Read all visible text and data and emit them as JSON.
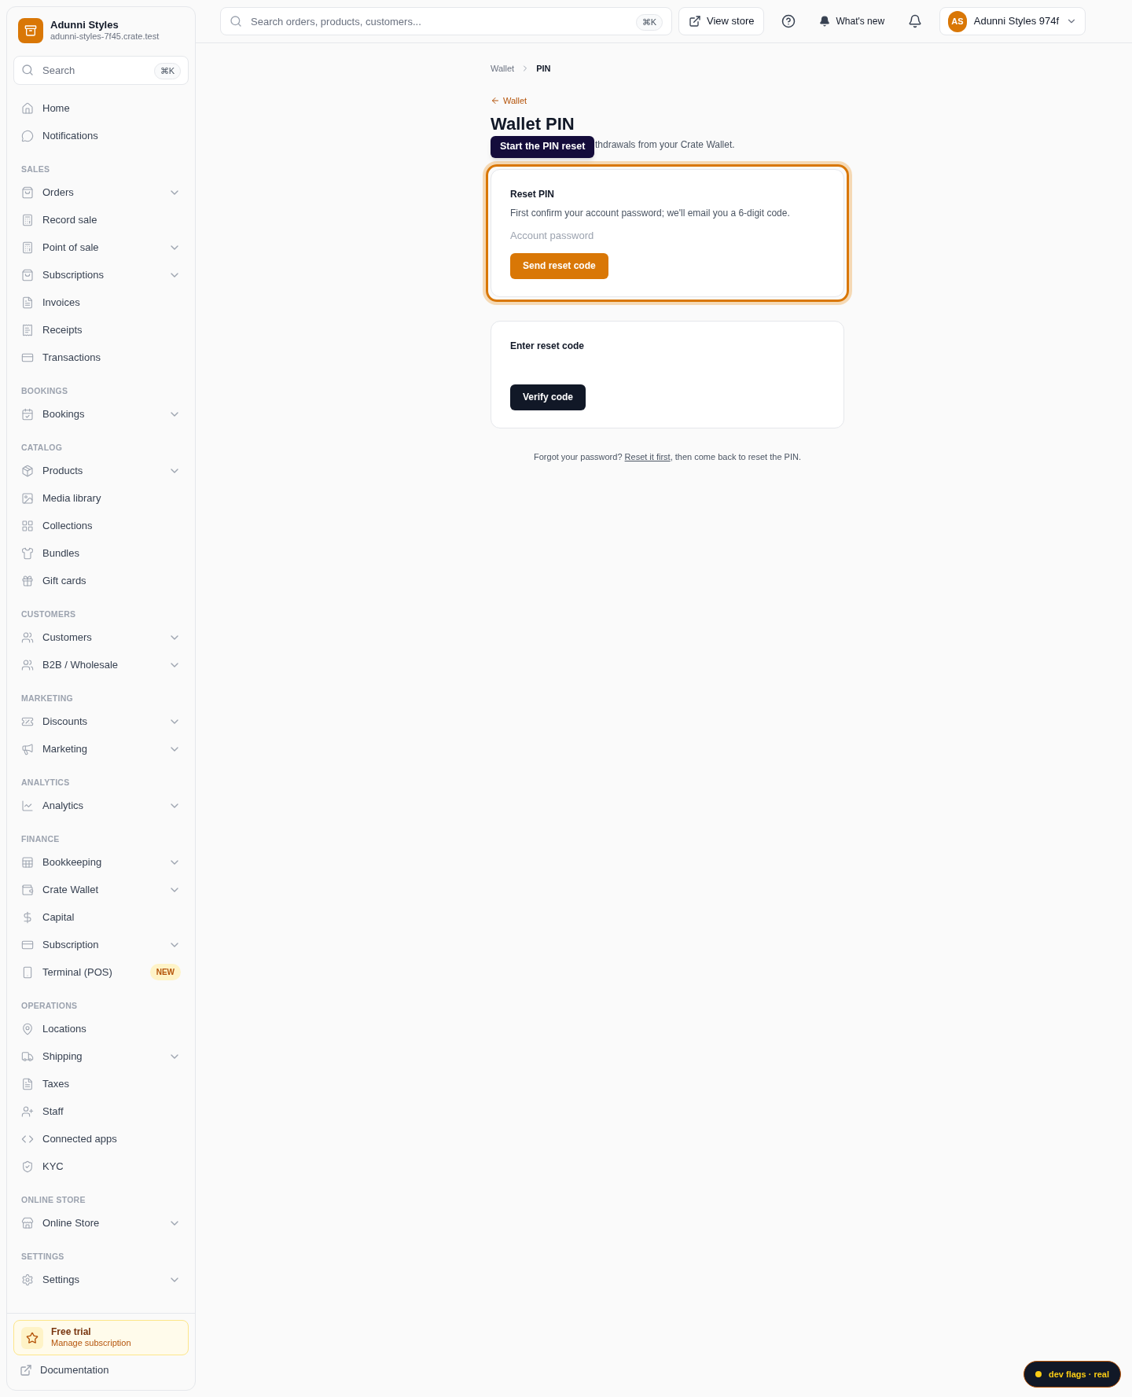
{
  "sidebar": {
    "store_name": "Adunni Styles",
    "store_domain": "adunni-styles-7f45.crate.test",
    "search": {
      "placeholder": "Search",
      "shortcut": "⌘K"
    },
    "top_items": [
      {
        "label": "Home",
        "expandable": false
      },
      {
        "label": "Notifications",
        "expandable": false
      }
    ],
    "sections": [
      {
        "heading": "SALES",
        "items": [
          {
            "label": "Orders",
            "expandable": true
          },
          {
            "label": "Record sale",
            "expandable": false
          },
          {
            "label": "Point of sale",
            "expandable": true
          },
          {
            "label": "Subscriptions",
            "expandable": true
          },
          {
            "label": "Invoices",
            "expandable": false
          },
          {
            "label": "Receipts",
            "expandable": false
          },
          {
            "label": "Transactions",
            "expandable": false
          }
        ]
      },
      {
        "heading": "BOOKINGS",
        "items": [
          {
            "label": "Bookings",
            "expandable": true
          }
        ]
      },
      {
        "heading": "CATALOG",
        "items": [
          {
            "label": "Products",
            "expandable": true
          },
          {
            "label": "Media library",
            "expandable": false
          },
          {
            "label": "Collections",
            "expandable": false
          },
          {
            "label": "Bundles",
            "expandable": false
          },
          {
            "label": "Gift cards",
            "expandable": false
          }
        ]
      },
      {
        "heading": "CUSTOMERS",
        "items": [
          {
            "label": "Customers",
            "expandable": true
          },
          {
            "label": "B2B / Wholesale",
            "expandable": true
          }
        ]
      },
      {
        "heading": "MARKETING",
        "items": [
          {
            "label": "Discounts",
            "expandable": true
          },
          {
            "label": "Marketing",
            "expandable": true
          }
        ]
      },
      {
        "heading": "ANALYTICS",
        "items": [
          {
            "label": "Analytics",
            "expandable": true
          }
        ]
      },
      {
        "heading": "FINANCE",
        "items": [
          {
            "label": "Bookkeeping",
            "expandable": true
          },
          {
            "label": "Crate Wallet",
            "expandable": true
          },
          {
            "label": "Capital",
            "expandable": false
          },
          {
            "label": "Subscription",
            "expandable": true
          },
          {
            "label": "Terminal (POS)",
            "expandable": false,
            "badge": "NEW"
          }
        ]
      },
      {
        "heading": "OPERATIONS",
        "items": [
          {
            "label": "Locations",
            "expandable": false
          },
          {
            "label": "Shipping",
            "expandable": true
          },
          {
            "label": "Taxes",
            "expandable": false
          },
          {
            "label": "Staff",
            "expandable": false
          },
          {
            "label": "Connected apps",
            "expandable": false
          },
          {
            "label": "KYC",
            "expandable": false
          }
        ]
      },
      {
        "heading": "ONLINE STORE",
        "items": [
          {
            "label": "Online Store",
            "expandable": true
          }
        ]
      },
      {
        "heading": "SETTINGS",
        "items": [
          {
            "label": "Settings",
            "expandable": true
          }
        ]
      }
    ],
    "trial": {
      "title": "Free trial",
      "link": "Manage subscription"
    },
    "documentation": "Documentation"
  },
  "header": {
    "search": {
      "placeholder": "Search orders, products, customers...",
      "shortcut": "⌘K"
    },
    "view_store": "View store",
    "whats_new": "What's new",
    "account": {
      "initials": "AS",
      "name": "Adunni Styles 974f"
    }
  },
  "breadcrumb": [
    {
      "label": "Wallet",
      "selected": false
    },
    {
      "label": "PIN",
      "selected": true
    }
  ],
  "back_link": "Wallet",
  "title": "Wallet PIN",
  "subtitle": "thdrawals from your Crate Wallet.",
  "tooltip": "Start the PIN reset",
  "cards": [
    {
      "title": "Reset PIN",
      "description": "First confirm your account password; we'll email you a 6-digit code.",
      "field_placeholder": "Account password",
      "button": "Send reset code",
      "kind": "primary",
      "highlighted": true
    },
    {
      "title": "Enter reset code",
      "button": "Verify code",
      "kind": "dark",
      "highlighted": false
    }
  ],
  "footer_note": {
    "before": "Forgot your password?",
    "link": "Reset it first",
    "after": ", then come back to reset the PIN."
  },
  "dev_badge": "dev flags · real"
}
